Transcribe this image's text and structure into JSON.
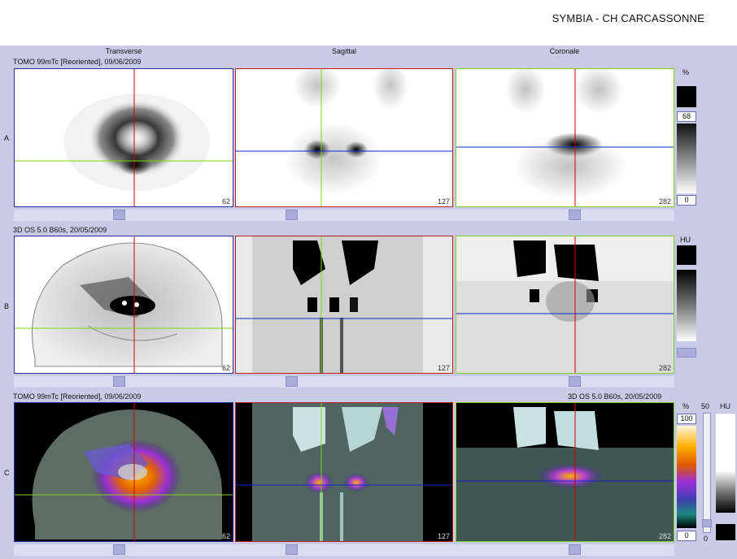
{
  "header": {
    "title": "SYMBIA - CH CARCASSONNE"
  },
  "columns": [
    "Transverse",
    "Sagittal",
    "Coronale"
  ],
  "rows": {
    "A": {
      "label": "A",
      "series": "TOMO 99mTc [Reoriented], 09/06/2009",
      "slices": [
        "62",
        "127",
        "282"
      ]
    },
    "B": {
      "label": "B",
      "series": "3D  OS  5.0  B60s, 20/05/2009",
      "slices": [
        "62",
        "127",
        "282"
      ]
    },
    "C": {
      "label": "C",
      "series_left": "TOMO 99mTc [Reoriented], 09/06/2009",
      "series_right": "3D  OS  5.0  B60s, 20/05/2009",
      "slices": [
        "62",
        "127",
        "282"
      ]
    }
  },
  "colorbars": {
    "A": {
      "unit": "%",
      "top": "68",
      "bottom": "0"
    },
    "B": {
      "unit": "HU"
    },
    "C": {
      "unit": "%",
      "top": "100",
      "bottom": "0",
      "mid_label": "50",
      "unit2": "HU",
      "bottom2": "0"
    }
  },
  "colors": {
    "background": "#c9cbe6",
    "crosshair_red": "#d40000",
    "crosshair_green": "#7fd31a",
    "crosshair_blue": "#1428c8"
  }
}
